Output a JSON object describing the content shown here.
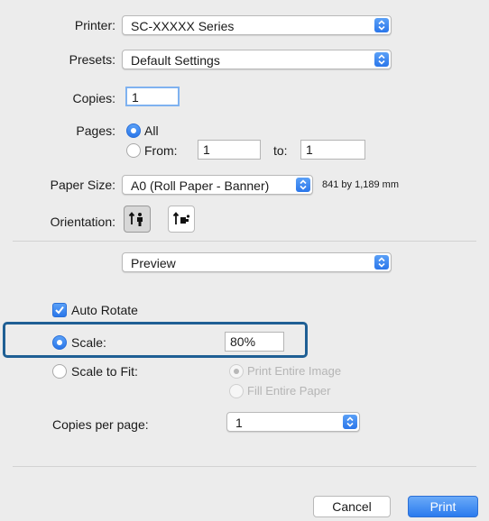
{
  "printer": {
    "label": "Printer:",
    "value": "SC-XXXXX Series"
  },
  "presets": {
    "label": "Presets:",
    "value": "Default Settings"
  },
  "copies": {
    "label": "Copies:",
    "value": "1"
  },
  "pages": {
    "label": "Pages:",
    "all_label": "All",
    "from_label": "From:",
    "from_value": "1",
    "to_label": "to:",
    "to_value": "1",
    "selected": "All"
  },
  "paper_size": {
    "label": "Paper Size:",
    "value": "A0 (Roll Paper - Banner)",
    "dimensions": "841 by 1,189 mm"
  },
  "orientation": {
    "label": "Orientation:",
    "selected": "portrait"
  },
  "section_popup": {
    "value": "Preview"
  },
  "auto_rotate": {
    "label": "Auto Rotate",
    "checked": true
  },
  "scale": {
    "label": "Scale:",
    "value": "80%",
    "selected": true
  },
  "scale_to_fit": {
    "label": "Scale to Fit:",
    "option_print_entire": "Print Entire Image",
    "option_fill_entire": "Fill Entire Paper"
  },
  "copies_per_page": {
    "label": "Copies per page:",
    "value": "1"
  },
  "buttons": {
    "cancel": "Cancel",
    "print": "Print"
  },
  "colors": {
    "accent": "#2a76ea",
    "highlight_border": "#1f5f94"
  }
}
